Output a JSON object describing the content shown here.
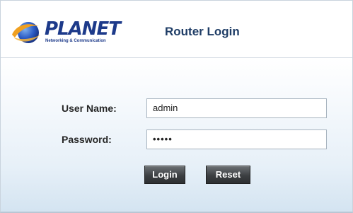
{
  "brand": {
    "name": "PLANET",
    "tagline": "Networking & Communication"
  },
  "header": {
    "title": "Router Login"
  },
  "form": {
    "username_label": "User Name:",
    "username_value": "admin",
    "password_label": "Password:",
    "password_value": "•••••"
  },
  "buttons": {
    "login": "Login",
    "reset": "Reset"
  },
  "colors": {
    "brand_blue": "#1d3a8a",
    "title_blue": "#1f3d66",
    "button_dark": "#3c3f42",
    "gradient_bottom": "#d4e4f1"
  },
  "icons": {
    "logo": "planet-globe-icon"
  }
}
